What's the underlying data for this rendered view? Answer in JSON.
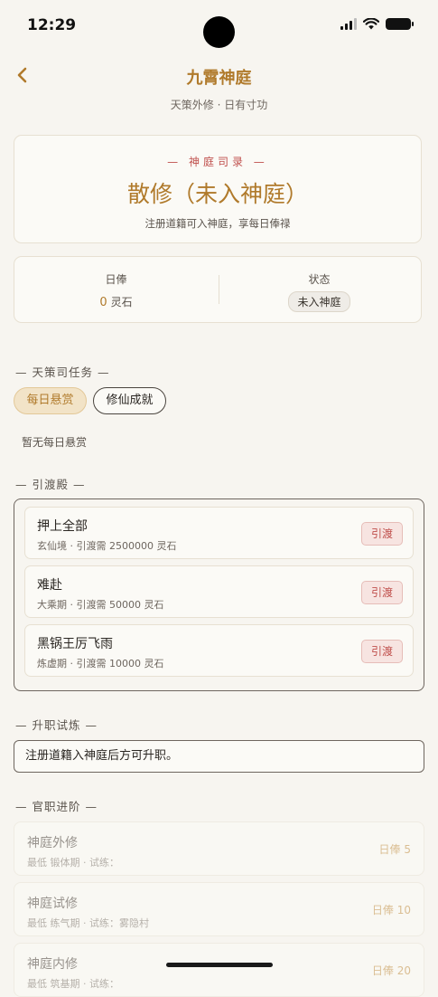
{
  "status": {
    "time": "12:29"
  },
  "header": {
    "title": "九霄神庭",
    "subtitle": "天策外修 · 日有寸功"
  },
  "hero": {
    "tag": "— 神庭司录 —",
    "title": "散修（未入神庭）",
    "desc": "注册道籍可入神庭，享每日俸禄"
  },
  "stats": {
    "salary_label": "日俸",
    "salary_value": "0",
    "salary_unit": "灵石",
    "status_label": "状态",
    "status_value": "未入神庭"
  },
  "tasks": {
    "section": "— 天策司任务 —",
    "tab_daily": "每日悬赏",
    "tab_achieve": "修仙成就",
    "empty": "暂无每日悬赏"
  },
  "yindu": {
    "section": "— 引渡殿 —",
    "items": [
      {
        "name": "押上全部",
        "meta": "玄仙境 · 引渡需 2500000 灵石",
        "btn": "引渡"
      },
      {
        "name": "难赴",
        "meta": "大乘期 · 引渡需 50000 灵石",
        "btn": "引渡"
      },
      {
        "name": "黑锅王厉飞雨",
        "meta": "炼虚期 · 引渡需 10000 灵石",
        "btn": "引渡"
      }
    ]
  },
  "promotion": {
    "section": "— 升职试炼 —",
    "notice": "注册道籍入神庭后方可升职。"
  },
  "ranks": {
    "section": "— 官职进阶 —",
    "items": [
      {
        "name": "神庭外修",
        "meta": "最低 锻体期 · 试练：",
        "pay": "日俸 5"
      },
      {
        "name": "神庭试修",
        "meta": "最低 练气期 · 试练：雾隐村",
        "pay": "日俸 10"
      },
      {
        "name": "神庭内修",
        "meta": "最低 筑基期 · 试练：",
        "pay": "日俸 20"
      }
    ]
  }
}
